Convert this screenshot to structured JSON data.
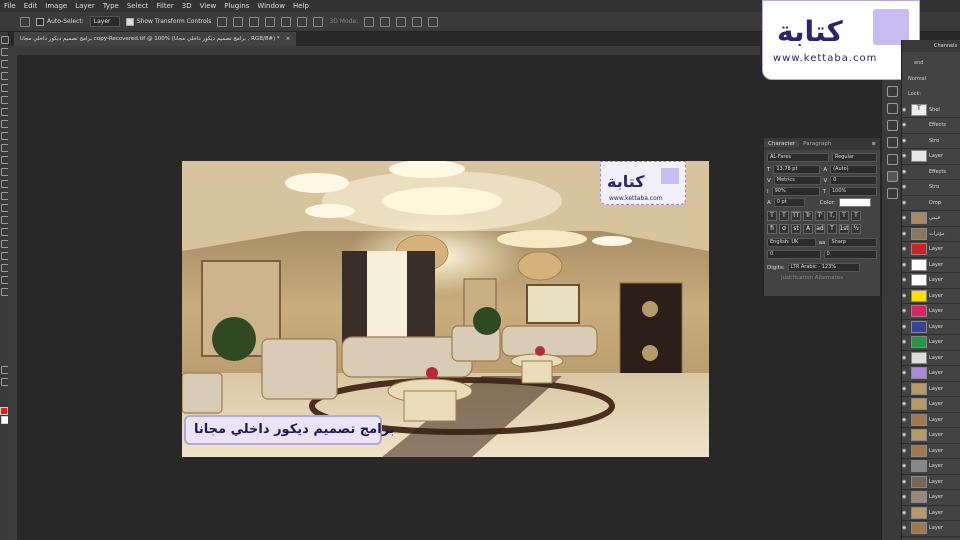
{
  "menu": [
    "File",
    "Edit",
    "Image",
    "Layer",
    "Type",
    "Select",
    "Filter",
    "3D",
    "View",
    "Plugins",
    "Window",
    "Help"
  ],
  "options": {
    "auto_select": "Auto-Select:",
    "layer_select": "Layer",
    "show_transform": "Show Transform Controls",
    "mode_3d": "3D Mode:"
  },
  "document_tab": {
    "title": "برامج تصميم ديكور داخلي مجانا copy-Recovered.tif @ 100% (برامج تصميم ديكور داخلي مجانا , RGB/8#) *",
    "close": "×"
  },
  "brand": {
    "word": "كتابة",
    "url": "www.kettaba.com"
  },
  "photo_caption": "برامج تصميم ديكور داخلي مجانا",
  "character_panel": {
    "tab_character": "Character",
    "tab_paragraph": "Paragraph",
    "font_family": "AL-Fares",
    "font_style": "Regular",
    "font_size": "13.78 pt",
    "leading": "(Auto)",
    "kerning": "Metrics",
    "tracking": "0",
    "vertical_scale": "90%",
    "horizontal_scale": "100%",
    "baseline_shift": "0 pt",
    "color_label": "Color:",
    "language": "English: UK",
    "antialias": "Sharp",
    "val_a": "0",
    "val_b": "0",
    "digits_label": "Digits:",
    "digits_value": "LTR Arabic - 123%",
    "justification": "Justification Alternates",
    "style_buttons": [
      "T",
      "T",
      "TT",
      "Tr",
      "T'",
      "T,",
      "T",
      "T"
    ],
    "ot_buttons": [
      "fi",
      "σ",
      "st",
      "A",
      "ad",
      "T",
      "1st",
      "½"
    ]
  },
  "layers_panel": {
    "tab_channels": "Channels",
    "blend": "Normal",
    "lock": "Lock:",
    "blend_partial": "end",
    "rows": [
      {
        "name": "Shel",
        "thumb": "T"
      },
      {
        "name": "Effects",
        "thumb": ""
      },
      {
        "name": "Stro",
        "thumb": ""
      },
      {
        "name": "Layer",
        "thumb": "#e6e6e6"
      },
      {
        "name": "Effects",
        "thumb": ""
      },
      {
        "name": "Stro",
        "thumb": ""
      },
      {
        "name": "Drop",
        "thumb": ""
      },
      {
        "name": "قيمي",
        "thumb": "#aa8866"
      },
      {
        "name": "مؤثرات",
        "thumb": "#8a7560"
      },
      {
        "name": "Layer",
        "thumb": "#cc2222"
      },
      {
        "name": "Layer",
        "thumb": "#ffffff"
      },
      {
        "name": "Layer",
        "thumb": "#ffffff"
      },
      {
        "name": "Layer",
        "thumb": "#ffdd00"
      },
      {
        "name": "Layer",
        "thumb": "#dd2266"
      },
      {
        "name": "Layer",
        "thumb": "#334499"
      },
      {
        "name": "Layer",
        "thumb": "#229944"
      },
      {
        "name": "Layer",
        "thumb": "#dddddd"
      },
      {
        "name": "Layer",
        "thumb": "#aa88dd"
      },
      {
        "name": "Layer",
        "thumb": "#b89a6a"
      },
      {
        "name": "Layer",
        "thumb": "#b89a6a"
      },
      {
        "name": "Layer",
        "thumb": "#a07850"
      },
      {
        "name": "Layer",
        "thumb": "#b89a6a"
      },
      {
        "name": "Layer",
        "thumb": "#a07850"
      },
      {
        "name": "Layer",
        "thumb": "#888888"
      },
      {
        "name": "Layer",
        "thumb": "#776655"
      },
      {
        "name": "Layer",
        "thumb": "#998877"
      },
      {
        "name": "Layer",
        "thumb": "#b89a6a"
      },
      {
        "name": "Layer",
        "thumb": "#a07850"
      }
    ]
  },
  "colors": {
    "accent_brand": "#2b2470",
    "foreground": "#e02020",
    "background": "#ffffff"
  }
}
